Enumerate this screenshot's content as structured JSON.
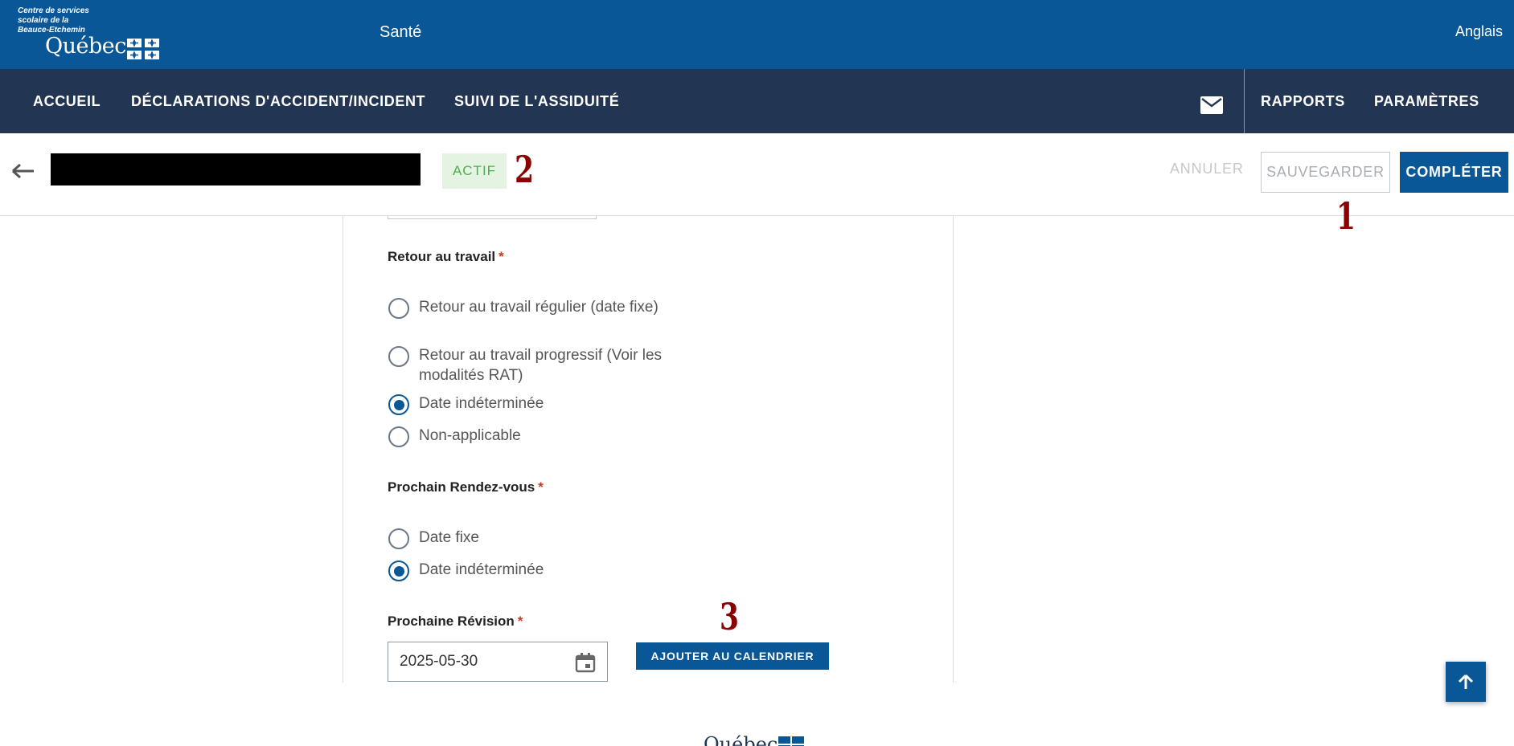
{
  "header": {
    "org_line1": "Centre de services",
    "org_line2": "scolaire de la",
    "org_line3": "Beauce-Etchemin",
    "logo_text": "Québec",
    "title": "Santé",
    "language_link": "Anglais"
  },
  "nav": {
    "items": [
      {
        "label": "ACCUEIL"
      },
      {
        "label": "DÉCLARATIONS D'ACCIDENT/INCIDENT"
      },
      {
        "label": "SUIVI DE L'ASSIDUITÉ"
      }
    ],
    "reports": "RAPPORTS",
    "settings": "PARAMÈTRES"
  },
  "action_bar": {
    "status": "ACTIF",
    "cancel": "ANNULER",
    "save": "SAUVEGARDER",
    "complete": "COMPLÉTER"
  },
  "annotations": {
    "one": "1",
    "two": "2",
    "three": "3"
  },
  "form": {
    "return_to_work": {
      "label": "Retour au travail",
      "required": "*",
      "options": [
        {
          "label": "Retour au travail régulier (date fixe)",
          "checked": false
        },
        {
          "label": "Retour au travail progressif (Voir les modalités RAT)",
          "checked": false
        },
        {
          "label": "Date indéterminée",
          "checked": true
        },
        {
          "label": "Non-applicable",
          "checked": false
        }
      ]
    },
    "next_appointment": {
      "label": "Prochain Rendez-vous",
      "required": "*",
      "options": [
        {
          "label": "Date fixe",
          "checked": false
        },
        {
          "label": "Date indéterminée",
          "checked": true
        }
      ]
    },
    "next_review": {
      "label": "Prochaine Révision",
      "required": "*",
      "value": "2025-05-30",
      "add_to_calendar": "AJOUTER AU CALENDRIER"
    }
  },
  "footer": {
    "logo_text": "Québec"
  },
  "colors": {
    "primary": "#095797",
    "nav": "#223654",
    "status_bg": "#e5f3e3",
    "status_text": "#4caf50",
    "required": "#cb381f",
    "annotation": "#8b0000"
  }
}
